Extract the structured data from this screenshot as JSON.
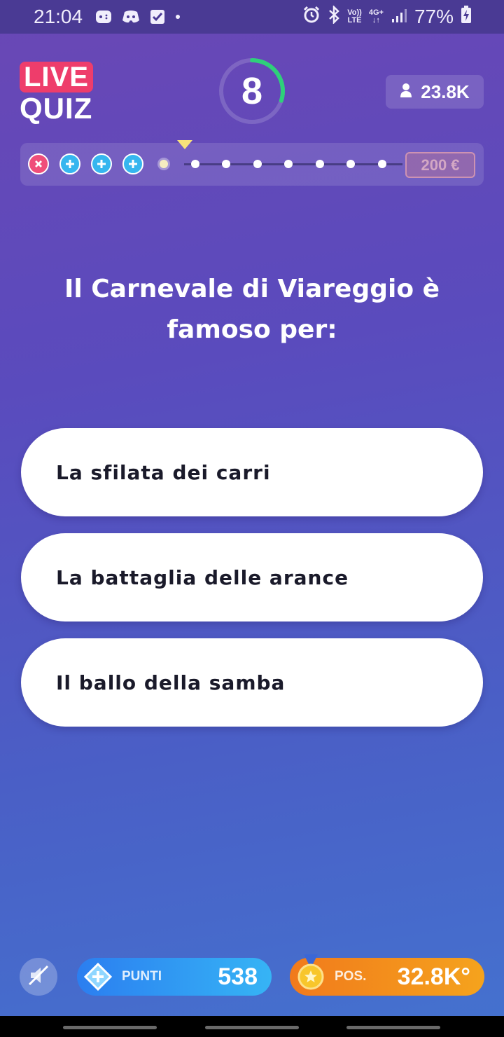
{
  "status_bar": {
    "time": "21:04",
    "battery": "77%",
    "net_top": "Vo))",
    "net_bottom": "LTE",
    "gen_top": "4G+",
    "gen_bottom": "↓↑",
    "icons": [
      "gamepad-icon",
      "discord-icon",
      "checkbox-icon",
      "alarm-icon",
      "bluetooth-icon",
      "signal-icon",
      "battery-charging-icon"
    ]
  },
  "header": {
    "logo_live": "LIVE",
    "logo_quiz": "QUIZ",
    "timer": "8",
    "timer_fraction_remaining": 0.3,
    "viewers": "23.8K"
  },
  "progress": {
    "steps_total": 12,
    "used": [
      "wrong",
      "extra-life",
      "extra-life",
      "extra-life"
    ],
    "current_index": 4,
    "prize": "200 €"
  },
  "question": {
    "text": "Il Carnevale di Viareggio è famoso per:"
  },
  "answers": [
    {
      "label": "La sfilata dei carri"
    },
    {
      "label": "La battaglia delle arance"
    },
    {
      "label": "Il ballo della samba"
    }
  ],
  "footer": {
    "points_label": "PUNTI",
    "points_value": "538",
    "pos_label": "POS.",
    "pos_value": "32.8K°"
  },
  "colors": {
    "accent_live": "#ee3d6b",
    "timer_arc": "#2ed07a",
    "points_pill": "#2b7ef0",
    "pos_pill": "#f17a1c"
  }
}
